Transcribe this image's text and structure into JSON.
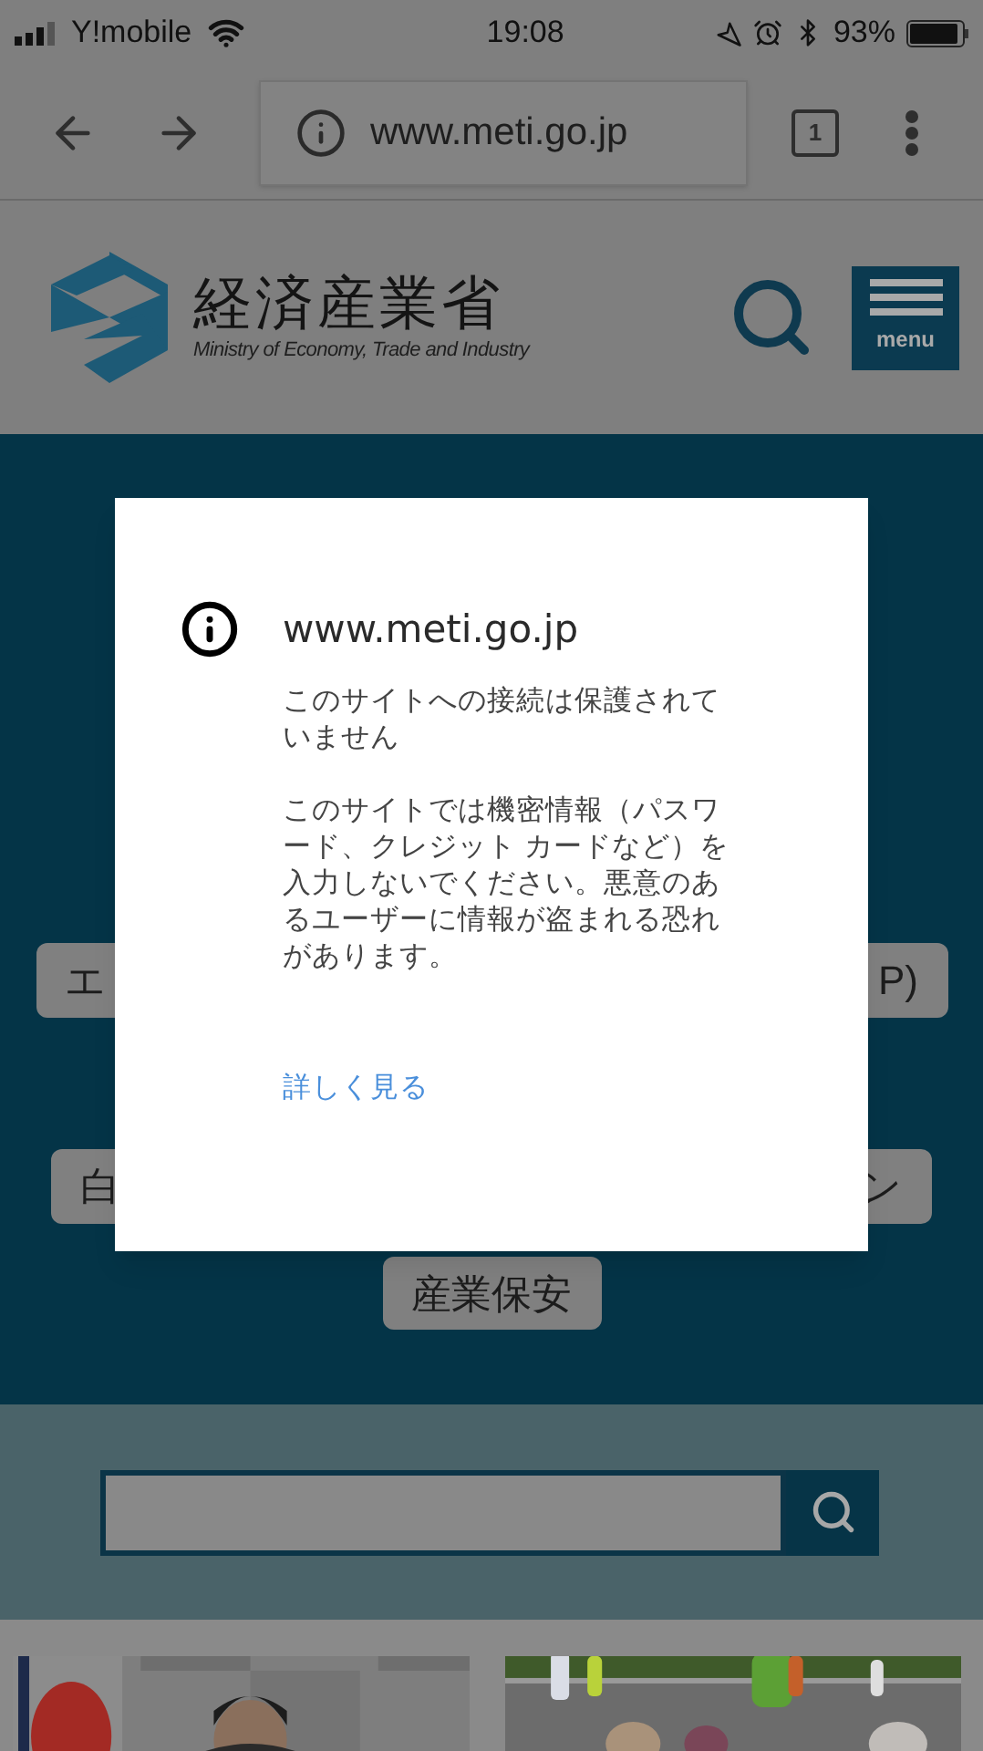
{
  "status_bar": {
    "carrier": "Y!mobile",
    "time": "19:08",
    "battery": "93%"
  },
  "browser": {
    "url": "www.meti.go.jp",
    "tab_count": "1"
  },
  "site_header": {
    "logo_title": "経済産業省",
    "logo_subtitle": "Ministry of Economy, Trade and Industry",
    "menu_label": "menu"
  },
  "link_buttons": [
    {
      "kind": "split",
      "label_left": "エ",
      "label_right": "P)"
    },
    {
      "kind": "split",
      "label_left": "白",
      "label_right": "ン"
    },
    {
      "kind": "full",
      "label": "産業保安"
    }
  ],
  "dialog": {
    "title": "www.meti.go.jp",
    "message": "このサイトへの接続は保護されていません",
    "detail": "このサイトでは機密情報（パスワード、クレジット カードなど）を入力しないでください。悪意のあるユーザーに情報が盗まれる恐れがあります。",
    "link": "詳しく見る"
  }
}
